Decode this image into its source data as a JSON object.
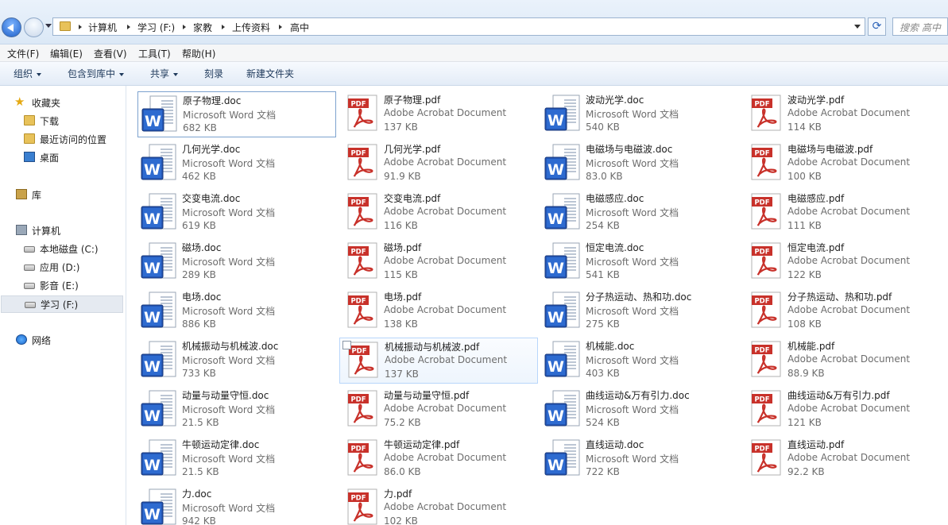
{
  "address": {
    "crumbs": [
      "计算机",
      "学习 (F:)",
      "家教",
      "上传资料",
      "高中"
    ],
    "search_placeholder": "搜索 高中"
  },
  "menu": [
    "文件(F)",
    "编辑(E)",
    "查看(V)",
    "工具(T)",
    "帮助(H)"
  ],
  "toolbar": {
    "organize": "组织",
    "include_in_library": "包含到库中",
    "share": "共享",
    "burn": "刻录",
    "new_folder": "新建文件夹"
  },
  "sidebar": {
    "favorites": "收藏夹",
    "downloads": "下载",
    "recent": "最近访问的位置",
    "desktop": "桌面",
    "libraries": "库",
    "computer": "计算机",
    "drive_c": "本地磁盘 (C:)",
    "drive_d": "应用 (D:)",
    "drive_e": "影音 (E:)",
    "drive_f": "学习 (F:)",
    "network": "网络"
  },
  "files": [
    {
      "name": "原子物理.doc",
      "type": "Microsoft Word 文档",
      "size": "682 KB",
      "kind": "word"
    },
    {
      "name": "原子物理.pdf",
      "type": "Adobe Acrobat Document",
      "size": "137 KB",
      "kind": "pdf"
    },
    {
      "name": "波动光学.doc",
      "type": "Microsoft Word 文档",
      "size": "540 KB",
      "kind": "word"
    },
    {
      "name": "波动光学.pdf",
      "type": "Adobe Acrobat Document",
      "size": "114 KB",
      "kind": "pdf"
    },
    {
      "name": "几何光学.doc",
      "type": "Microsoft Word 文档",
      "size": "462 KB",
      "kind": "word"
    },
    {
      "name": "几何光学.pdf",
      "type": "Adobe Acrobat Document",
      "size": "91.9 KB",
      "kind": "pdf"
    },
    {
      "name": "电磁场与电磁波.doc",
      "type": "Microsoft Word 文档",
      "size": "83.0 KB",
      "kind": "word"
    },
    {
      "name": "电磁场与电磁波.pdf",
      "type": "Adobe Acrobat Document",
      "size": "100 KB",
      "kind": "pdf"
    },
    {
      "name": "交变电流.doc",
      "type": "Microsoft Word 文档",
      "size": "619 KB",
      "kind": "word"
    },
    {
      "name": "交变电流.pdf",
      "type": "Adobe Acrobat Document",
      "size": "116 KB",
      "kind": "pdf"
    },
    {
      "name": "电磁感应.doc",
      "type": "Microsoft Word 文档",
      "size": "254 KB",
      "kind": "word"
    },
    {
      "name": "电磁感应.pdf",
      "type": "Adobe Acrobat Document",
      "size": "111 KB",
      "kind": "pdf"
    },
    {
      "name": "磁场.doc",
      "type": "Microsoft Word 文档",
      "size": "289 KB",
      "kind": "word"
    },
    {
      "name": "磁场.pdf",
      "type": "Adobe Acrobat Document",
      "size": "115 KB",
      "kind": "pdf"
    },
    {
      "name": "恒定电流.doc",
      "type": "Microsoft Word 文档",
      "size": "541 KB",
      "kind": "word"
    },
    {
      "name": "恒定电流.pdf",
      "type": "Adobe Acrobat Document",
      "size": "122 KB",
      "kind": "pdf"
    },
    {
      "name": "电场.doc",
      "type": "Microsoft Word 文档",
      "size": "886 KB",
      "kind": "word"
    },
    {
      "name": "电场.pdf",
      "type": "Adobe Acrobat Document",
      "size": "138 KB",
      "kind": "pdf"
    },
    {
      "name": "分子热运动、热和功.doc",
      "type": "Microsoft Word 文档",
      "size": "275 KB",
      "kind": "word"
    },
    {
      "name": "分子热运动、热和功.pdf",
      "type": "Adobe Acrobat Document",
      "size": "108 KB",
      "kind": "pdf"
    },
    {
      "name": "机械振动与机械波.doc",
      "type": "Microsoft Word 文档",
      "size": "733 KB",
      "kind": "word"
    },
    {
      "name": "机械振动与机械波.pdf",
      "type": "Adobe Acrobat Document",
      "size": "137 KB",
      "kind": "pdf"
    },
    {
      "name": "机械能.doc",
      "type": "Microsoft Word 文档",
      "size": "403 KB",
      "kind": "word"
    },
    {
      "name": "机械能.pdf",
      "type": "Adobe Acrobat Document",
      "size": "88.9 KB",
      "kind": "pdf"
    },
    {
      "name": "动量与动量守恒.doc",
      "type": "Microsoft Word 文档",
      "size": "21.5 KB",
      "kind": "word"
    },
    {
      "name": "动量与动量守恒.pdf",
      "type": "Adobe Acrobat Document",
      "size": "75.2 KB",
      "kind": "pdf"
    },
    {
      "name": "曲线运动&万有引力.doc",
      "type": "Microsoft Word 文档",
      "size": "524 KB",
      "kind": "word"
    },
    {
      "name": "曲线运动&万有引力.pdf",
      "type": "Adobe Acrobat Document",
      "size": "121 KB",
      "kind": "pdf"
    },
    {
      "name": "牛顿运动定律.doc",
      "type": "Microsoft Word 文档",
      "size": "21.5 KB",
      "kind": "word"
    },
    {
      "name": "牛顿运动定律.pdf",
      "type": "Adobe Acrobat Document",
      "size": "86.0 KB",
      "kind": "pdf"
    },
    {
      "name": "直线运动.doc",
      "type": "Microsoft Word 文档",
      "size": "722 KB",
      "kind": "word"
    },
    {
      "name": "直线运动.pdf",
      "type": "Adobe Acrobat Document",
      "size": "92.2 KB",
      "kind": "pdf"
    },
    {
      "name": "力.doc",
      "type": "Microsoft Word 文档",
      "size": "942 KB",
      "kind": "word"
    },
    {
      "name": "力.pdf",
      "type": "Adobe Acrobat Document",
      "size": "102 KB",
      "kind": "pdf"
    }
  ],
  "pdf_icon_label": "PDF",
  "word_icon_letter": "W"
}
